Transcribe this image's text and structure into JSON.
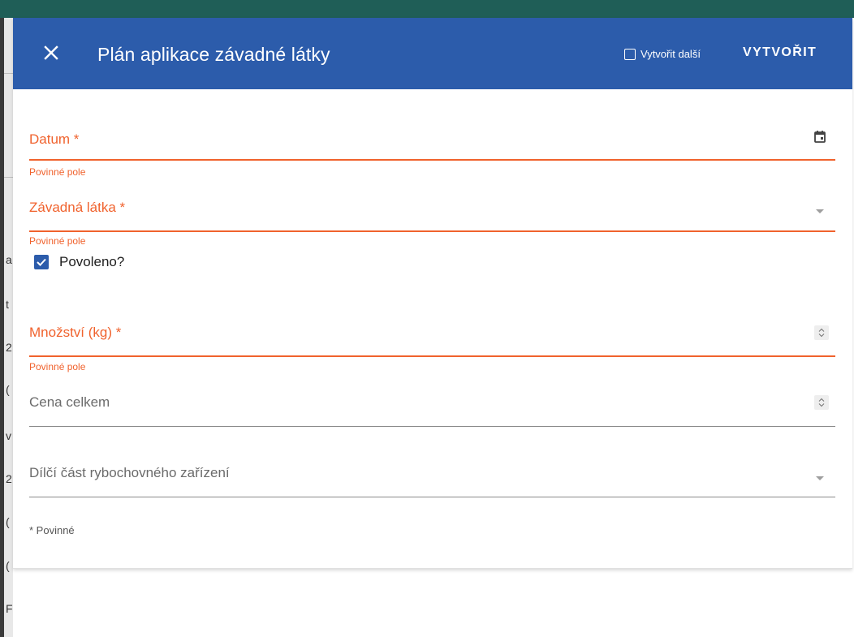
{
  "background": {
    "left_chars": [
      "a",
      "t",
      "2",
      "(",
      "v",
      "2",
      "(",
      "(",
      "F"
    ]
  },
  "dialog": {
    "close_icon": "close-icon",
    "title": "Plán aplikace závadné látky",
    "create_another_label": "Vytvořit další",
    "create_another_checked": false,
    "create_button_label": "VYTVOŘIT"
  },
  "form": {
    "date": {
      "label": "Datum *",
      "helper": "Povinné pole",
      "icon": "calendar-icon"
    },
    "substance": {
      "label": "Závadná látka *",
      "helper": "Povinné pole",
      "icon": "chevron-down-icon"
    },
    "allowed": {
      "label": "Povoleno?",
      "checked": true
    },
    "quantity": {
      "label": "Množství (kg) *",
      "helper": "Povinné pole",
      "icon": "spinner-icon"
    },
    "total_price": {
      "label": "Cena celkem",
      "icon": "spinner-icon"
    },
    "facility_part": {
      "label": "Dílčí část rybochovného zařízení",
      "icon": "chevron-down-icon"
    },
    "required_note": "* Povinné"
  },
  "colors": {
    "header": "#2c5cab",
    "error": "#f0622d",
    "topbar": "#1f5e57"
  }
}
